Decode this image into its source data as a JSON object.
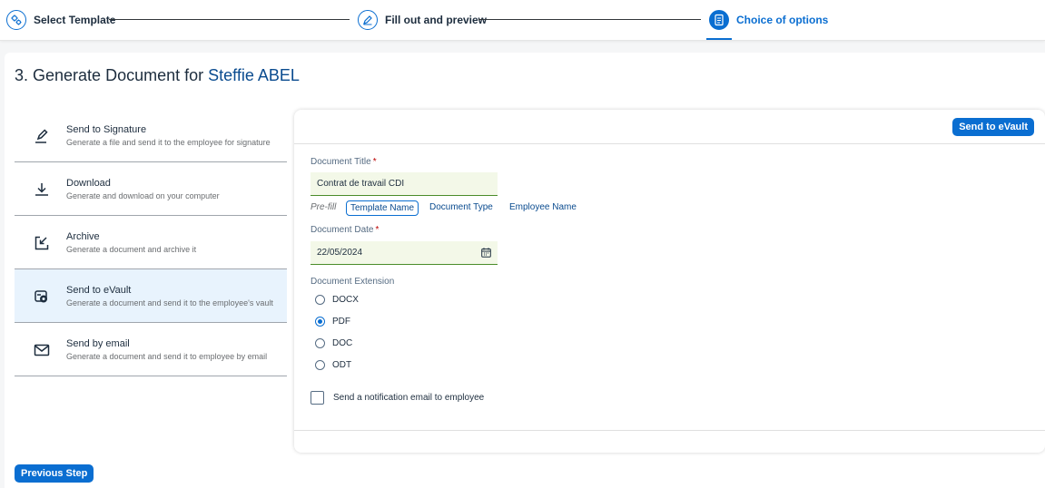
{
  "wizard": {
    "steps": [
      {
        "label": "Select Template",
        "icon": "settings-cogs-icon"
      },
      {
        "label": "Fill out and preview",
        "icon": "edit-pencil-icon"
      },
      {
        "label": "Choice of options",
        "icon": "document-icon"
      }
    ],
    "active_step": 3
  },
  "page": {
    "title_prefix": "3. Generate Document for",
    "employee_name": "Steffie ABEL"
  },
  "options": [
    {
      "title": "Send to Signature",
      "description": "Generate a file and send it to the employee for signature",
      "icon": "signature-pen-icon"
    },
    {
      "title": "Download",
      "description": "Generate and download on your computer",
      "icon": "download-icon"
    },
    {
      "title": "Archive",
      "description": "Generate a document and archive it",
      "icon": "archive-icon"
    },
    {
      "title": "Send to eVault",
      "description": "Generate a document and send it to the employee's vault",
      "icon": "evault-icon"
    },
    {
      "title": "Send by email",
      "description": "Generate a document and send it to employee by email",
      "icon": "email-icon"
    }
  ],
  "selected_option": "Send to eVault",
  "form": {
    "action_button": "Send to eVault",
    "document_title": {
      "label": "Document Title",
      "required_mark": "*",
      "value": "Contrat de travail CDI"
    },
    "prefill": {
      "label": "Pre-fill",
      "options": [
        "Template Name",
        "Document Type",
        "Employee Name"
      ],
      "active": "Template Name"
    },
    "document_date": {
      "label": "Document Date",
      "required_mark": "*",
      "value": "22/05/2024",
      "icon": "calendar-icon"
    },
    "document_extension": {
      "label": "Document Extension",
      "options": [
        "DOCX",
        "PDF",
        "DOC",
        "ODT"
      ],
      "selected": "PDF"
    },
    "notification": {
      "label": "Send a notification email to employee",
      "checked": false
    }
  },
  "footer": {
    "previous_button": "Previous Step"
  },
  "colors": {
    "accent": "#0a6ed1",
    "link": "#0a4b8f",
    "selected_row": "#e8f3fd",
    "input_bg": "#f3f8e8"
  }
}
